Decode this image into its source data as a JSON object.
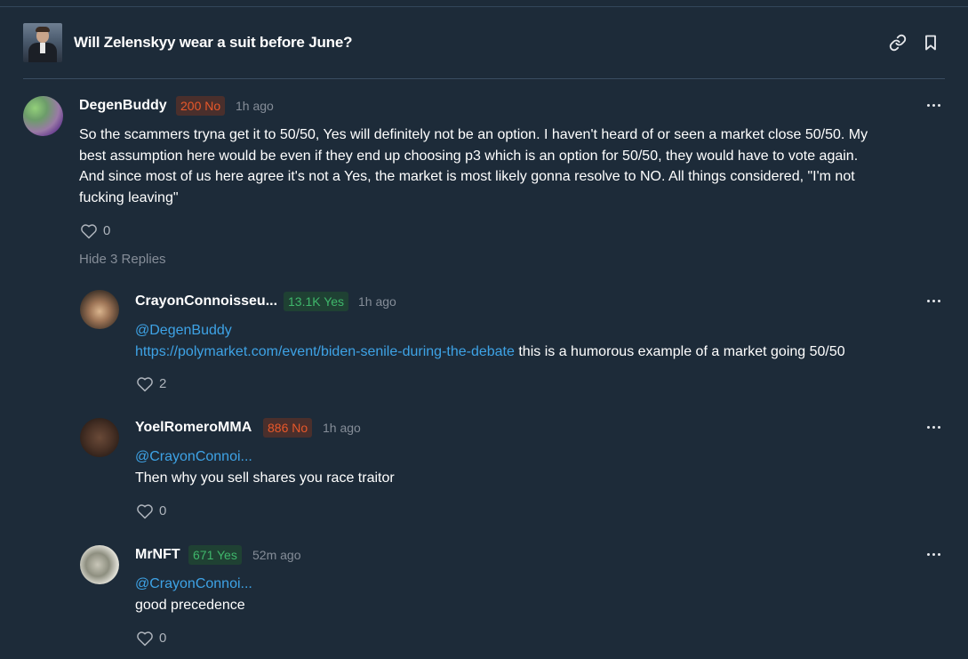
{
  "market": {
    "title": "Will Zelenskyy wear a suit before June?",
    "icons": [
      "link-icon",
      "bookmark-icon"
    ]
  },
  "colors": {
    "background": "#1d2b39",
    "mention": "#3ea3e6",
    "no_badge_text": "#e8582a",
    "yes_badge_text": "#3fb66b"
  },
  "comments": [
    {
      "username": "DegenBuddy",
      "badge": "200 No",
      "badge_side": "No",
      "time": "1h ago",
      "text_lines": [
        "So the scammers tryna get it to 50/50, Yes will definitely not be an option. I haven't heard of or seen a market close 50/50. My",
        "best assumption here would be even if they end up choosing p3 which is an option for 50/50, they would have to vote again.",
        "And since most of us here agree it's not a Yes, the market is most likely gonna resolve to NO. All things considered, \"I'm not",
        "fucking leaving\""
      ],
      "likes": "0",
      "hide_replies": "Hide 3 Replies"
    },
    {
      "username": "CrayonConnoisseu...",
      "badge": "13.1K Yes",
      "badge_side": "Yes",
      "time": "1h ago",
      "mention": "@DegenBuddy",
      "link": "https://polymarket.com/event/biden-senile-during-the-debate",
      "text": " this is a humorous example of a market going 50/50",
      "likes": "2"
    },
    {
      "username": "YoelRomeroMMA",
      "badge": "886 No",
      "badge_side": "No",
      "time": "1h ago",
      "mention": "@CrayonConnoi...",
      "text": "Then why you sell shares you race traitor",
      "likes": "0"
    },
    {
      "username": "MrNFT",
      "badge": "671 Yes",
      "badge_side": "Yes",
      "time": "52m ago",
      "mention": "@CrayonConnoi...",
      "text": "good precedence",
      "likes": "0"
    }
  ]
}
